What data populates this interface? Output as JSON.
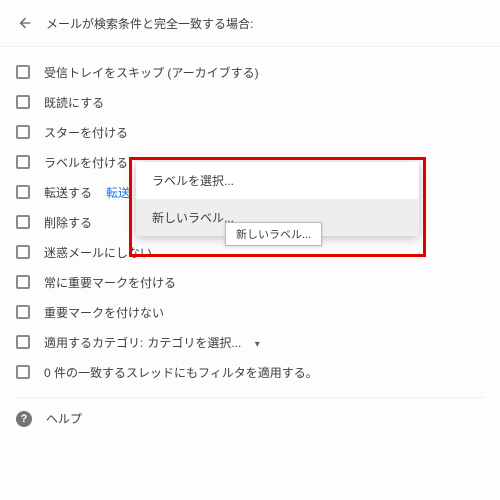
{
  "header": {
    "title": "メールが検索条件と完全一致する場合:"
  },
  "options": {
    "skip_inbox": "受信トレイをスキップ (アーカイブする)",
    "mark_read": "既読にする",
    "star": "スターを付ける",
    "apply_label_prefix": "ラベルを付ける:",
    "forward": "転送する",
    "forward_link_partial": "転送",
    "delete": "削除する",
    "not_spam": "迷惑メールにしない",
    "always_important": "常に重要マークを付ける",
    "never_important": "重要マークを付けない",
    "category_prefix": "適用するカテゴリ:",
    "category_value": "カテゴリを選択...",
    "apply_to_matching": "0 件の一致するスレッドにもフィルタを適用する。"
  },
  "dropdown": {
    "choose_label": "ラベルを選択...",
    "new_label": "新しいラベル..."
  },
  "tooltip": {
    "new_label": "新しいラベル..."
  },
  "help": {
    "label": "ヘルプ"
  }
}
